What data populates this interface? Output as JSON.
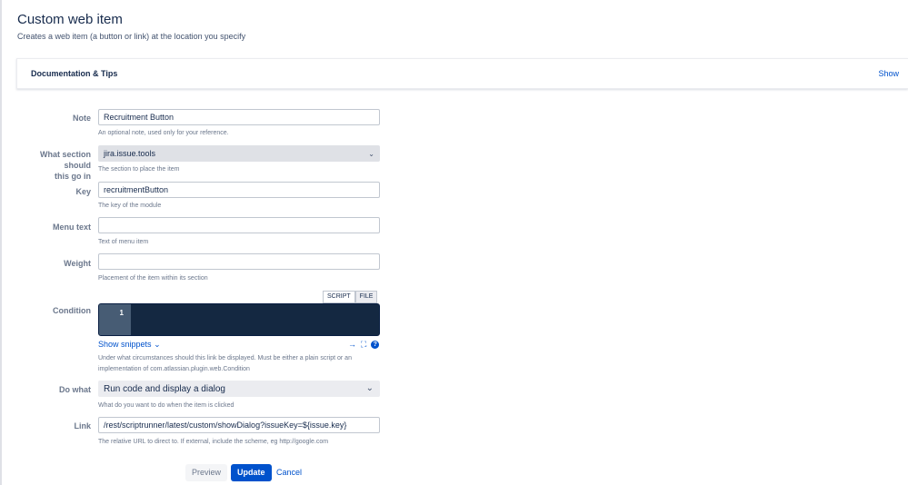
{
  "header": {
    "title": "Custom web item",
    "subtitle": "Creates a web item (a button or link) at the location you specify"
  },
  "docs": {
    "title": "Documentation & Tips",
    "show_label": "Show"
  },
  "form": {
    "note": {
      "label": "Note",
      "value": "Recruitment Button",
      "hint": "An optional note, used only for your reference."
    },
    "section": {
      "label_line1": "What section should",
      "label_line2": "this go in",
      "value": "jira.issue.tools",
      "hint": "The section to place the item"
    },
    "key": {
      "label": "Key",
      "value": "recruitmentButton",
      "hint": "The key of the module"
    },
    "menu_text": {
      "label": "Menu text",
      "value": "",
      "hint": "Text of menu item"
    },
    "weight": {
      "label": "Weight",
      "value": "",
      "hint": "Placement of the item within its section"
    },
    "condition": {
      "label": "Condition",
      "tabs": [
        "SCRIPT",
        "FILE"
      ],
      "line_number": "1",
      "snippets_label": "Show snippets",
      "hint_line1": "Under what circumstances should this link be displayed. Must be either a plain script or an",
      "hint_line2": "implementation of com.atlassian.plugin.web.Condition"
    },
    "do_what": {
      "label": "Do what",
      "value": "Run code and display a dialog",
      "hint": "What do you want to do when the item is clicked"
    },
    "link": {
      "label": "Link",
      "value": "/rest/scriptrunner/latest/custom/showDialog?issueKey=${issue.key}",
      "hint": "The relative URL to direct to. If external, include the scheme, eg http://google.com"
    }
  },
  "actions": {
    "preview": "Preview",
    "update": "Update",
    "cancel": "Cancel"
  },
  "colors": {
    "accent": "#0052cc",
    "editor_bg": "#142841",
    "gutter_bg": "#475c74"
  }
}
